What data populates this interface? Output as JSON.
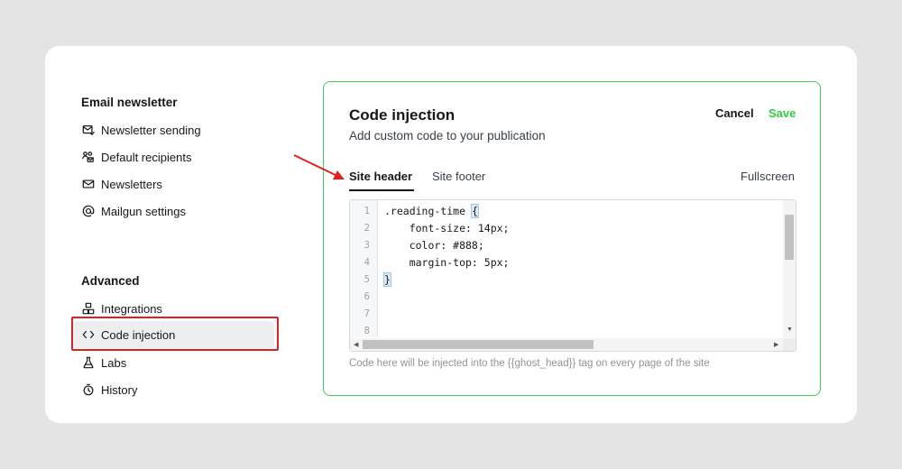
{
  "sidebar": {
    "email_section": {
      "title": "Email newsletter",
      "items": [
        {
          "label": "Newsletter sending",
          "icon": "mail-send-icon"
        },
        {
          "label": "Default recipients",
          "icon": "users-mail-icon"
        },
        {
          "label": "Newsletters",
          "icon": "envelope-icon"
        },
        {
          "label": "Mailgun settings",
          "icon": "at-sign-icon"
        }
      ]
    },
    "advanced_section": {
      "title": "Advanced",
      "items": [
        {
          "label": "Integrations",
          "icon": "integrations-icon"
        },
        {
          "label": "Code injection",
          "icon": "code-icon",
          "active": true
        },
        {
          "label": "Labs",
          "icon": "flask-icon"
        },
        {
          "label": "History",
          "icon": "history-icon"
        }
      ]
    }
  },
  "panel": {
    "title": "Code injection",
    "subtitle": "Add custom code to your publication",
    "cancel_label": "Cancel",
    "save_label": "Save",
    "tabs": [
      {
        "label": "Site header",
        "active": true
      },
      {
        "label": "Site footer",
        "active": false
      }
    ],
    "fullscreen_label": "Fullscreen",
    "editor": {
      "line_numbers": [
        "1",
        "2",
        "3",
        "4",
        "5",
        "6",
        "7",
        "8"
      ],
      "lines": [
        ".reading-time {",
        "    font-size: 14px;",
        "    color: #888;",
        "    margin-top: 5px;",
        "}",
        "",
        "",
        ""
      ]
    },
    "hint": "Code here will be injected into the {{ghost_head}} tag on every page of the site"
  },
  "colors": {
    "accent_green": "#30cf43",
    "panel_border": "#48c75a",
    "annotation_red": "#e02020"
  }
}
